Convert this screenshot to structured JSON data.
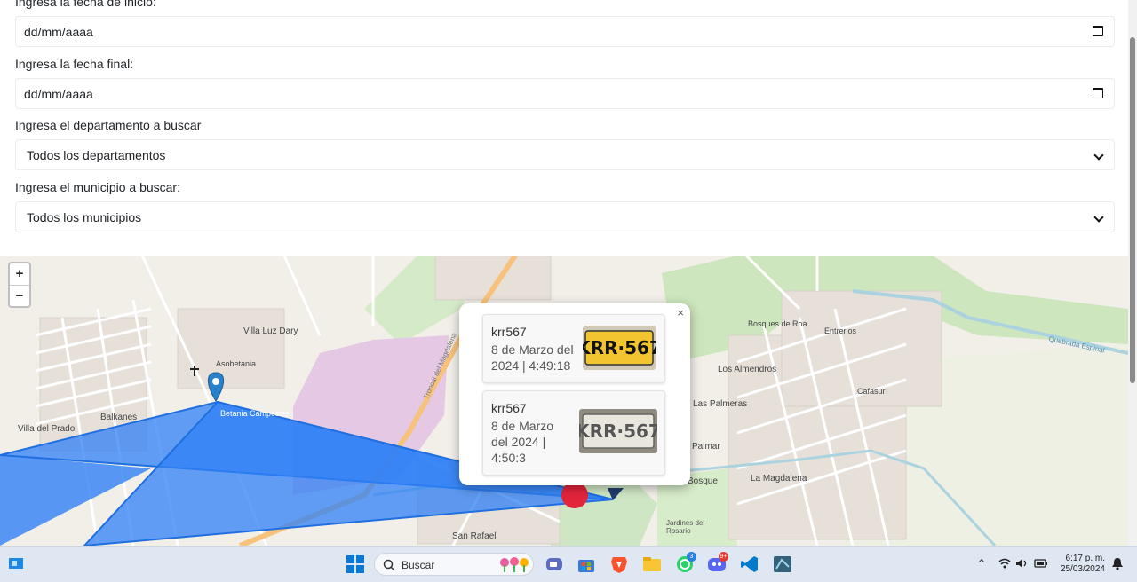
{
  "form": {
    "start_label": "Ingresa la fecha de inicio:",
    "start_value": "dd/mm/aaaa",
    "end_label": "Ingresa la fecha final:",
    "end_value": "dd/mm/aaaa",
    "dept_label": "Ingresa el departamento a buscar",
    "dept_value": "Todos los departamentos",
    "muni_label": "Ingresa el municipio a buscar:",
    "muni_value": "Todos los municipios"
  },
  "map": {
    "zoom_in": "+",
    "zoom_out": "−",
    "labels": {
      "villa_luz_dary": "Villa Luz Dary",
      "villa_del_prado": "Villa del Prado",
      "balkanes": "Balkanes",
      "betania_campestre": "Betania Campestre",
      "asobetania": "Asobetania",
      "bosques_de_roa": "Bosques de Roa",
      "entrerios": "Entrerios",
      "los_almendros": "Los Almendros",
      "las_palmeras": "Las Palmeras",
      "la_magdalena": "La Magdalena",
      "san_rafael": "San Rafael",
      "jardines": "Jardines del Rosario",
      "cafasur": "Cafasur",
      "troncal": "Troncal del Magdalena",
      "quebrada_espinal": "Quebrada Espinal",
      "palmar": "Palmar",
      "bosque": "Bosque"
    }
  },
  "popup": {
    "close": "×",
    "records": [
      {
        "plate": "krr567",
        "date": "8 de Marzo del 2024 | 4:49:18",
        "plate_text": "KRR·567"
      },
      {
        "plate": "krr567",
        "date": "8 de Marzo del 2024 | 4:50:3",
        "plate_text": "KRR·567"
      }
    ]
  },
  "taskbar": {
    "search_label": "Buscar",
    "time": "6:17 p. m.",
    "date": "25/03/2024",
    "whatsapp_badge": "3",
    "discord_badge": "9+"
  }
}
